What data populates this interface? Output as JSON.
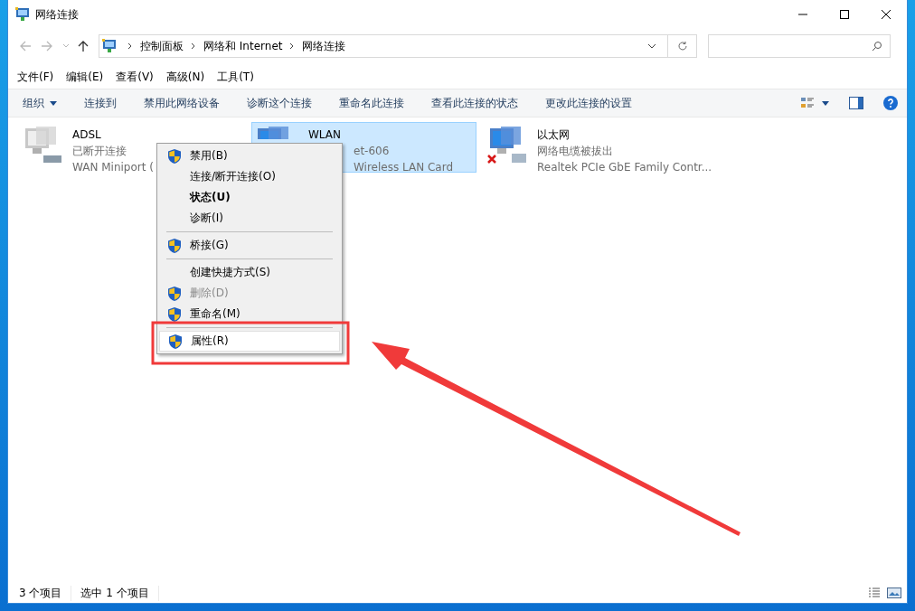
{
  "window": {
    "title": "网络连接"
  },
  "address_bar": {
    "crumbs": [
      "控制面板",
      "网络和 Internet",
      "网络连接"
    ]
  },
  "menu_bar": [
    "文件(F)",
    "编辑(E)",
    "查看(V)",
    "高级(N)",
    "工具(T)"
  ],
  "toolbar": [
    {
      "label": "组织",
      "kind": "dropdown"
    },
    {
      "label": "连接到",
      "kind": "button"
    },
    {
      "label": "禁用此网络设备",
      "kind": "button"
    },
    {
      "label": "诊断这个连接",
      "kind": "button"
    },
    {
      "label": "重命名此连接",
      "kind": "button"
    },
    {
      "label": "查看此连接的状态",
      "kind": "button"
    },
    {
      "label": "更改此连接的设置",
      "kind": "button"
    }
  ],
  "connections": [
    {
      "name": "ADSL",
      "status": "已断开连接",
      "device": "WAN Miniport (",
      "selected": false,
      "kind": "dialup",
      "partly_hidden": false
    },
    {
      "name": "WLAN",
      "status": "et-606",
      "device": "Wireless LAN Card",
      "selected": true,
      "kind": "wireless",
      "partly_hidden": true
    },
    {
      "name": "以太网",
      "status": "网络电缆被拔出",
      "device": "Realtek PCIe GbE Family Contr...",
      "selected": false,
      "kind": "ethernet_unplugged",
      "partly_hidden": false
    }
  ],
  "context_menu": [
    {
      "kind": "item",
      "label": "禁用(B)",
      "shield": true,
      "bold": false,
      "disabled": false,
      "selected": false
    },
    {
      "kind": "item",
      "label": "连接/断开连接(O)",
      "shield": false,
      "bold": false,
      "disabled": false,
      "selected": false
    },
    {
      "kind": "item",
      "label": "状态(U)",
      "shield": false,
      "bold": true,
      "disabled": false,
      "selected": false
    },
    {
      "kind": "item",
      "label": "诊断(I)",
      "shield": false,
      "bold": false,
      "disabled": false,
      "selected": false
    },
    {
      "kind": "separator"
    },
    {
      "kind": "item",
      "label": "桥接(G)",
      "shield": true,
      "bold": false,
      "disabled": false,
      "selected": false
    },
    {
      "kind": "separator"
    },
    {
      "kind": "item",
      "label": "创建快捷方式(S)",
      "shield": false,
      "bold": false,
      "disabled": false,
      "selected": false
    },
    {
      "kind": "item",
      "label": "删除(D)",
      "shield": true,
      "bold": false,
      "disabled": true,
      "selected": false
    },
    {
      "kind": "item",
      "label": "重命名(M)",
      "shield": true,
      "bold": false,
      "disabled": false,
      "selected": false
    },
    {
      "kind": "separator"
    },
    {
      "kind": "item",
      "label": "属性(R)",
      "shield": true,
      "bold": false,
      "disabled": false,
      "selected": true
    }
  ],
  "status_bar": [
    "3 个项目",
    "选中 1 个项目"
  ]
}
